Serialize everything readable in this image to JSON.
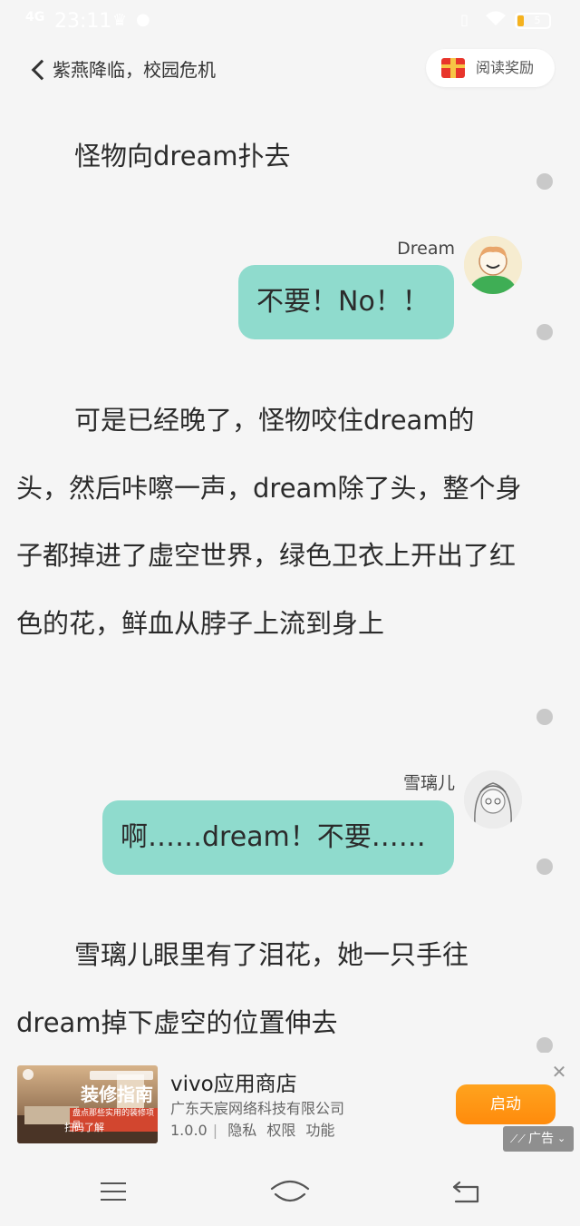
{
  "status_bar": {
    "signal": "4G",
    "time": "23:11",
    "battery_level": "5"
  },
  "header": {
    "title": "紫燕降临，校园危机",
    "reward_label": "阅读奖励"
  },
  "story": [
    {
      "type": "text",
      "text": "怪物向dream扑去"
    },
    {
      "type": "dialog",
      "speaker": "Dream",
      "text": "不要！No！！"
    },
    {
      "type": "text",
      "text": "可是已经晚了，怪物咬住dream的头，然后咔嚓一声，dream除了头，整个身子都掉进了虚空世界，绿色卫衣上开出了红色的花，鲜血从脖子上流到身上"
    },
    {
      "type": "dialog",
      "speaker": "雪璃儿",
      "text": "啊……dream！不要……"
    },
    {
      "type": "text",
      "text": "雪璃儿眼里有了泪花，她一只手往dream掉下虚空的位置伸去"
    }
  ],
  "ad": {
    "image_text": "装修指南",
    "image_subtext": "盘点那些实用的装修项目",
    "image_caption": "扫码了解",
    "title": "vivo应用商店",
    "company": "广东天宸网络科技有限公司",
    "version": "1.0.0",
    "links": [
      "隐私",
      "权限",
      "功能"
    ],
    "launch_label": "启动",
    "badge_label": "广告"
  },
  "icons": {
    "back": "chevron-left-icon",
    "gift": "gift-icon",
    "close": "close-icon",
    "menu": "menu-icon",
    "home": "home-icon",
    "return": "return-icon"
  },
  "colors": {
    "bubble": "#8fdbcd",
    "launch_button": "#ff9a16",
    "background": "#f5f5f5"
  }
}
